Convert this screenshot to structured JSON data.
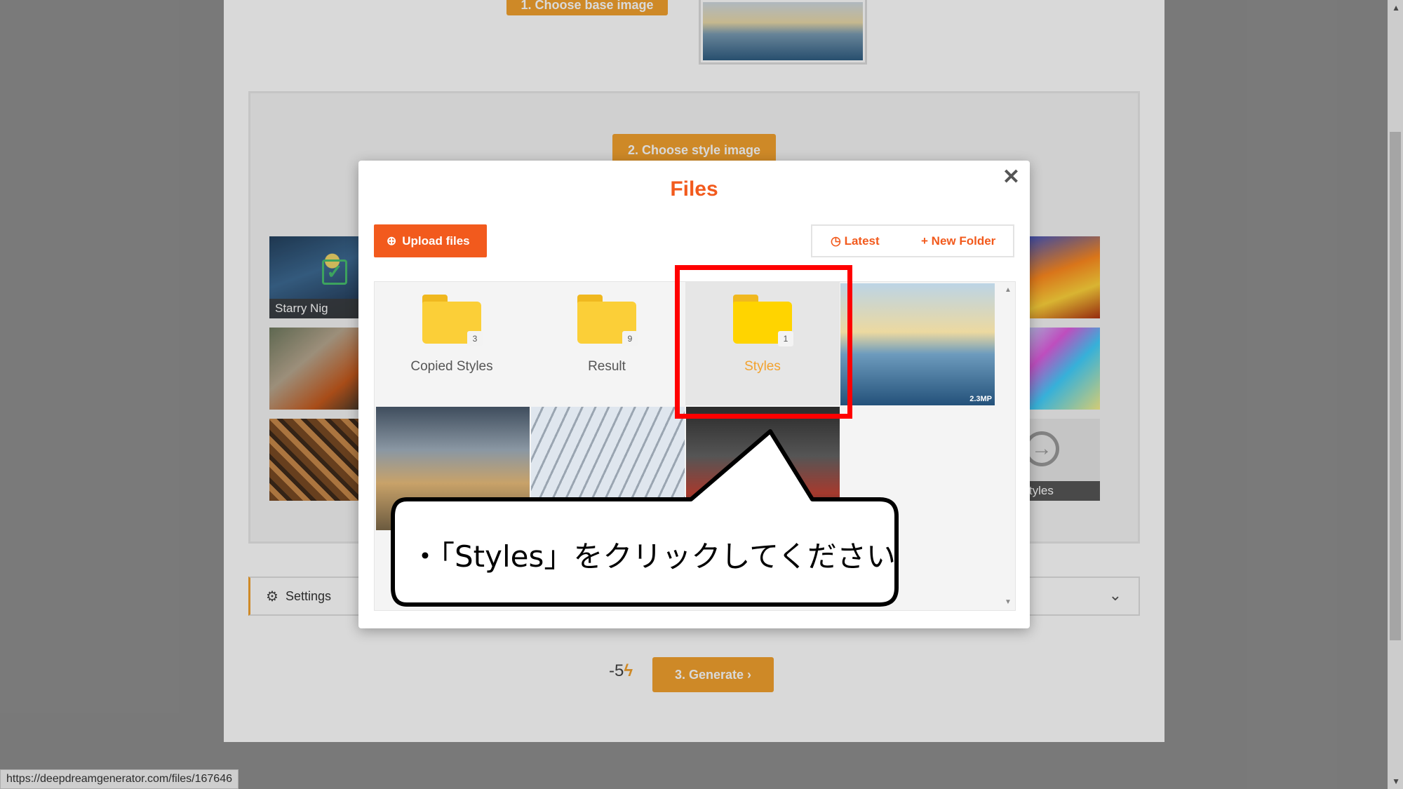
{
  "page": {
    "step1_label": "1. Choose base image",
    "step2_label": "2. Choose style image",
    "gallery": [
      {
        "caption": "Starry Nig"
      },
      {
        "caption": ""
      },
      {
        "caption": ""
      },
      {
        "caption": ""
      },
      {
        "caption": ""
      },
      {
        "caption": "r styles"
      }
    ],
    "settings_label": "Settings",
    "cost": "-5",
    "generate_label": "3. Generate"
  },
  "modal": {
    "title": "Files",
    "upload_label": "Upload files",
    "latest_label": "Latest",
    "new_folder_label": "New Folder",
    "folders": [
      {
        "name": "Copied Styles",
        "count": "3"
      },
      {
        "name": "Result",
        "count": "9"
      },
      {
        "name": "Styles",
        "count": "1"
      }
    ],
    "image_badge": "2.3MP"
  },
  "annotation": {
    "callout_text": "・「Styles」をクリックしてください"
  },
  "status_bar": {
    "url": "https://deepdreamgenerator.com/files/167646"
  },
  "colors": {
    "accent_orange": "#f25a1d",
    "button_orange": "#f2a22e",
    "highlight_red": "#ff0000"
  }
}
